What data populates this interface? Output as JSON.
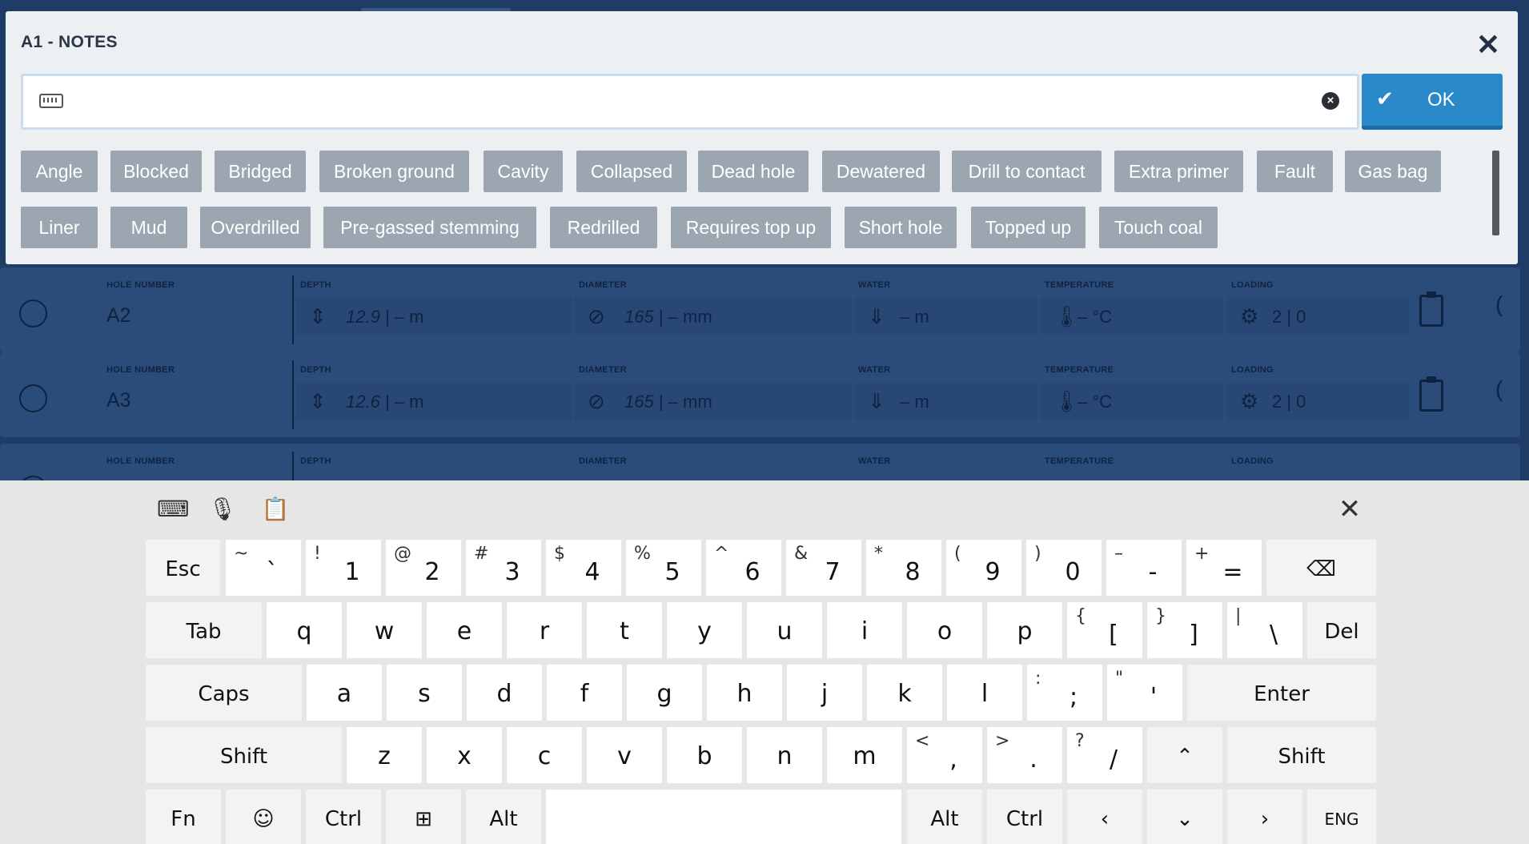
{
  "background": {
    "labels": {
      "hole_number": "HOLE NUMBER",
      "depth": "DEPTH",
      "diameter": "DIAMETER",
      "water": "WATER",
      "temperature": "TEMPERATURE",
      "loading": "LOADING"
    },
    "rows": [
      {
        "hole": "A2",
        "depth": "12.9",
        "depth_unit": " |  –  m",
        "diameter": "165",
        "diameter_unit": " |  –  mm",
        "water": "–  m",
        "temperature": "–  °C",
        "loading": "2 | 0"
      },
      {
        "hole": "A3",
        "depth": "12.6",
        "depth_unit": " |  –  m",
        "diameter": "165",
        "diameter_unit": " |  –  mm",
        "water": "–  m",
        "temperature": "–  °C",
        "loading": "2 | 0"
      }
    ]
  },
  "dialog": {
    "title": "A1 - NOTES",
    "input_value": "",
    "ok_label": "OK",
    "chips_row1": [
      "Angle",
      "Blocked",
      "Bridged",
      "Broken ground",
      "Cavity",
      "Collapsed",
      "Dead hole",
      "Dewatered",
      "Drill to contact",
      "Extra primer",
      "Fault",
      "Gas bag"
    ],
    "chips_row2": [
      "Liner",
      "Mud",
      "Overdrilled",
      "Pre-gassed stemming",
      "Redrilled",
      "Requires top up",
      "Short hole",
      "Topped up",
      "Touch coal"
    ]
  },
  "keyboard": {
    "row1": [
      {
        "main": "Esc"
      },
      {
        "main": "`",
        "shift": "~"
      },
      {
        "main": "1",
        "shift": "!"
      },
      {
        "main": "2",
        "shift": "@"
      },
      {
        "main": "3",
        "shift": "#"
      },
      {
        "main": "4",
        "shift": "$"
      },
      {
        "main": "5",
        "shift": "%"
      },
      {
        "main": "6",
        "shift": "^"
      },
      {
        "main": "7",
        "shift": "&"
      },
      {
        "main": "8",
        "shift": "*"
      },
      {
        "main": "9",
        "shift": "("
      },
      {
        "main": "0",
        "shift": ")"
      },
      {
        "main": "-",
        "shift": "–"
      },
      {
        "main": "=",
        "shift": "+"
      },
      {
        "main": "⌫"
      }
    ],
    "row2": [
      {
        "main": "Tab"
      },
      {
        "main": "q"
      },
      {
        "main": "w"
      },
      {
        "main": "e"
      },
      {
        "main": "r"
      },
      {
        "main": "t"
      },
      {
        "main": "y"
      },
      {
        "main": "u"
      },
      {
        "main": "i"
      },
      {
        "main": "o"
      },
      {
        "main": "p"
      },
      {
        "main": "[",
        "shift": "{"
      },
      {
        "main": "]",
        "shift": "}"
      },
      {
        "main": "\\",
        "shift": "|"
      },
      {
        "main": "Del"
      }
    ],
    "row3": [
      {
        "main": "Caps"
      },
      {
        "main": "a"
      },
      {
        "main": "s"
      },
      {
        "main": "d"
      },
      {
        "main": "f"
      },
      {
        "main": "g"
      },
      {
        "main": "h"
      },
      {
        "main": "j"
      },
      {
        "main": "k"
      },
      {
        "main": "l"
      },
      {
        "main": ";",
        "shift": ":"
      },
      {
        "main": "'",
        "shift": "\""
      },
      {
        "main": "Enter"
      }
    ],
    "row4": [
      {
        "main": "Shift"
      },
      {
        "main": "z"
      },
      {
        "main": "x"
      },
      {
        "main": "c"
      },
      {
        "main": "v"
      },
      {
        "main": "b"
      },
      {
        "main": "n"
      },
      {
        "main": "m"
      },
      {
        "main": ",",
        "shift": "<"
      },
      {
        "main": ".",
        "shift": ">"
      },
      {
        "main": "/",
        "shift": "?"
      },
      {
        "main": "⌃"
      },
      {
        "main": "Shift"
      }
    ],
    "row5": [
      {
        "main": "Fn"
      },
      {
        "main": "☺"
      },
      {
        "main": "Ctrl"
      },
      {
        "main": "⊞"
      },
      {
        "main": "Alt"
      },
      {
        "main": ""
      },
      {
        "main": "Alt"
      },
      {
        "main": "Ctrl"
      },
      {
        "main": "‹"
      },
      {
        "main": "⌄"
      },
      {
        "main": "›"
      },
      {
        "main": "ENG"
      }
    ]
  }
}
